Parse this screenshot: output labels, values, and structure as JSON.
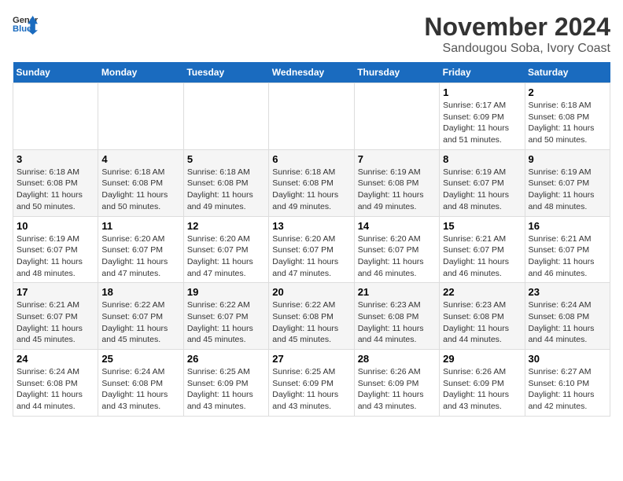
{
  "logo": {
    "line1": "General",
    "line2": "Blue"
  },
  "title": "November 2024",
  "subtitle": "Sandougou Soba, Ivory Coast",
  "days_of_week": [
    "Sunday",
    "Monday",
    "Tuesday",
    "Wednesday",
    "Thursday",
    "Friday",
    "Saturday"
  ],
  "weeks": [
    [
      {
        "day": "",
        "info": ""
      },
      {
        "day": "",
        "info": ""
      },
      {
        "day": "",
        "info": ""
      },
      {
        "day": "",
        "info": ""
      },
      {
        "day": "",
        "info": ""
      },
      {
        "day": "1",
        "info": "Sunrise: 6:17 AM\nSunset: 6:09 PM\nDaylight: 11 hours and 51 minutes."
      },
      {
        "day": "2",
        "info": "Sunrise: 6:18 AM\nSunset: 6:08 PM\nDaylight: 11 hours and 50 minutes."
      }
    ],
    [
      {
        "day": "3",
        "info": "Sunrise: 6:18 AM\nSunset: 6:08 PM\nDaylight: 11 hours and 50 minutes."
      },
      {
        "day": "4",
        "info": "Sunrise: 6:18 AM\nSunset: 6:08 PM\nDaylight: 11 hours and 50 minutes."
      },
      {
        "day": "5",
        "info": "Sunrise: 6:18 AM\nSunset: 6:08 PM\nDaylight: 11 hours and 49 minutes."
      },
      {
        "day": "6",
        "info": "Sunrise: 6:18 AM\nSunset: 6:08 PM\nDaylight: 11 hours and 49 minutes."
      },
      {
        "day": "7",
        "info": "Sunrise: 6:19 AM\nSunset: 6:08 PM\nDaylight: 11 hours and 49 minutes."
      },
      {
        "day": "8",
        "info": "Sunrise: 6:19 AM\nSunset: 6:07 PM\nDaylight: 11 hours and 48 minutes."
      },
      {
        "day": "9",
        "info": "Sunrise: 6:19 AM\nSunset: 6:07 PM\nDaylight: 11 hours and 48 minutes."
      }
    ],
    [
      {
        "day": "10",
        "info": "Sunrise: 6:19 AM\nSunset: 6:07 PM\nDaylight: 11 hours and 48 minutes."
      },
      {
        "day": "11",
        "info": "Sunrise: 6:20 AM\nSunset: 6:07 PM\nDaylight: 11 hours and 47 minutes."
      },
      {
        "day": "12",
        "info": "Sunrise: 6:20 AM\nSunset: 6:07 PM\nDaylight: 11 hours and 47 minutes."
      },
      {
        "day": "13",
        "info": "Sunrise: 6:20 AM\nSunset: 6:07 PM\nDaylight: 11 hours and 47 minutes."
      },
      {
        "day": "14",
        "info": "Sunrise: 6:20 AM\nSunset: 6:07 PM\nDaylight: 11 hours and 46 minutes."
      },
      {
        "day": "15",
        "info": "Sunrise: 6:21 AM\nSunset: 6:07 PM\nDaylight: 11 hours and 46 minutes."
      },
      {
        "day": "16",
        "info": "Sunrise: 6:21 AM\nSunset: 6:07 PM\nDaylight: 11 hours and 46 minutes."
      }
    ],
    [
      {
        "day": "17",
        "info": "Sunrise: 6:21 AM\nSunset: 6:07 PM\nDaylight: 11 hours and 45 minutes."
      },
      {
        "day": "18",
        "info": "Sunrise: 6:22 AM\nSunset: 6:07 PM\nDaylight: 11 hours and 45 minutes."
      },
      {
        "day": "19",
        "info": "Sunrise: 6:22 AM\nSunset: 6:07 PM\nDaylight: 11 hours and 45 minutes."
      },
      {
        "day": "20",
        "info": "Sunrise: 6:22 AM\nSunset: 6:08 PM\nDaylight: 11 hours and 45 minutes."
      },
      {
        "day": "21",
        "info": "Sunrise: 6:23 AM\nSunset: 6:08 PM\nDaylight: 11 hours and 44 minutes."
      },
      {
        "day": "22",
        "info": "Sunrise: 6:23 AM\nSunset: 6:08 PM\nDaylight: 11 hours and 44 minutes."
      },
      {
        "day": "23",
        "info": "Sunrise: 6:24 AM\nSunset: 6:08 PM\nDaylight: 11 hours and 44 minutes."
      }
    ],
    [
      {
        "day": "24",
        "info": "Sunrise: 6:24 AM\nSunset: 6:08 PM\nDaylight: 11 hours and 44 minutes."
      },
      {
        "day": "25",
        "info": "Sunrise: 6:24 AM\nSunset: 6:08 PM\nDaylight: 11 hours and 43 minutes."
      },
      {
        "day": "26",
        "info": "Sunrise: 6:25 AM\nSunset: 6:09 PM\nDaylight: 11 hours and 43 minutes."
      },
      {
        "day": "27",
        "info": "Sunrise: 6:25 AM\nSunset: 6:09 PM\nDaylight: 11 hours and 43 minutes."
      },
      {
        "day": "28",
        "info": "Sunrise: 6:26 AM\nSunset: 6:09 PM\nDaylight: 11 hours and 43 minutes."
      },
      {
        "day": "29",
        "info": "Sunrise: 6:26 AM\nSunset: 6:09 PM\nDaylight: 11 hours and 43 minutes."
      },
      {
        "day": "30",
        "info": "Sunrise: 6:27 AM\nSunset: 6:10 PM\nDaylight: 11 hours and 42 minutes."
      }
    ]
  ]
}
